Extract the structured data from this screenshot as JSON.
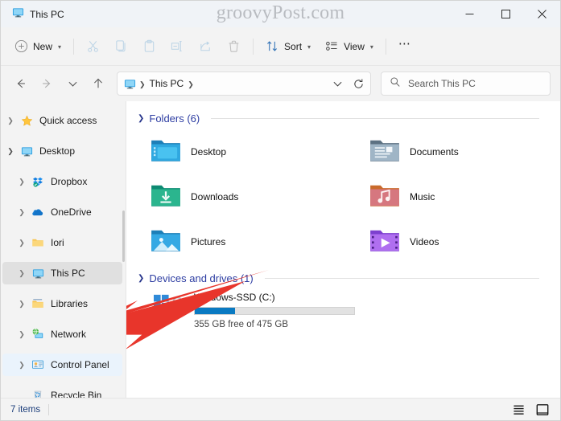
{
  "window": {
    "tab_title": "This PC",
    "watermark": "groovyPost.com",
    "controls": {
      "minimize": "Minimize",
      "maximize": "Maximize",
      "close": "Close"
    }
  },
  "toolbar": {
    "new_label": "New",
    "cut_label": "Cut",
    "copy_label": "Copy",
    "paste_label": "Paste",
    "rename_label": "Rename",
    "share_label": "Share",
    "delete_label": "Delete",
    "sort_label": "Sort",
    "view_label": "View",
    "more_label": "See more"
  },
  "address": {
    "back_label": "Back",
    "forward_label": "Forward",
    "recent_label": "Recent locations",
    "up_label": "Up",
    "crumb": "This PC",
    "dropdown_label": "Previous locations",
    "refresh_label": "Refresh"
  },
  "search": {
    "placeholder": "Search This PC",
    "value": ""
  },
  "sidebar": {
    "items": [
      {
        "label": "Quick access",
        "icon": "star-icon",
        "expander": "collapsed",
        "indent": 0,
        "state": "normal"
      },
      {
        "label": "Desktop",
        "icon": "monitor-icon",
        "expander": "expanded",
        "indent": 0,
        "state": "normal"
      },
      {
        "label": "Dropbox",
        "icon": "dropbox-icon",
        "expander": "collapsed",
        "indent": 1,
        "state": "normal"
      },
      {
        "label": "OneDrive",
        "icon": "cloud-icon",
        "expander": "collapsed",
        "indent": 1,
        "state": "normal"
      },
      {
        "label": "Iori",
        "icon": "folder-icon",
        "expander": "collapsed",
        "indent": 1,
        "state": "normal"
      },
      {
        "label": "This PC",
        "icon": "monitor-icon",
        "expander": "collapsed",
        "indent": 1,
        "state": "selected"
      },
      {
        "label": "Libraries",
        "icon": "libraries-icon",
        "expander": "collapsed",
        "indent": 1,
        "state": "normal"
      },
      {
        "label": "Network",
        "icon": "network-icon",
        "expander": "collapsed",
        "indent": 1,
        "state": "normal"
      },
      {
        "label": "Control Panel",
        "icon": "control-panel-icon",
        "expander": "collapsed",
        "indent": 1,
        "state": "hover"
      },
      {
        "label": "Recycle Bin",
        "icon": "recycle-bin-icon",
        "expander": "none",
        "indent": 1,
        "state": "normal"
      }
    ]
  },
  "content": {
    "folders_group": {
      "title": "Folders (6)",
      "items": [
        {
          "label": "Desktop",
          "icon": "desktop-folder-icon"
        },
        {
          "label": "Documents",
          "icon": "documents-folder-icon"
        },
        {
          "label": "Downloads",
          "icon": "downloads-folder-icon"
        },
        {
          "label": "Music",
          "icon": "music-folder-icon"
        },
        {
          "label": "Pictures",
          "icon": "pictures-folder-icon"
        },
        {
          "label": "Videos",
          "icon": "videos-folder-icon"
        }
      ]
    },
    "drives_group": {
      "title": "Devices and drives (1)",
      "items": [
        {
          "name": "Windows-SSD (C:)",
          "icon": "windows-drive-bitlocker-icon",
          "capacity_text": "355 GB free of 475 GB",
          "used_percent": 25
        }
      ]
    }
  },
  "status": {
    "item_count": "7 items",
    "details_view_label": "Details view",
    "large_icons_view_label": "Large icons view"
  },
  "colors": {
    "accent": "#2d3da2",
    "progress_fill": "#0a7ac2",
    "selection": "#e0e0e0",
    "hover": "#eaf3fc",
    "arrow": "#e8352b"
  }
}
